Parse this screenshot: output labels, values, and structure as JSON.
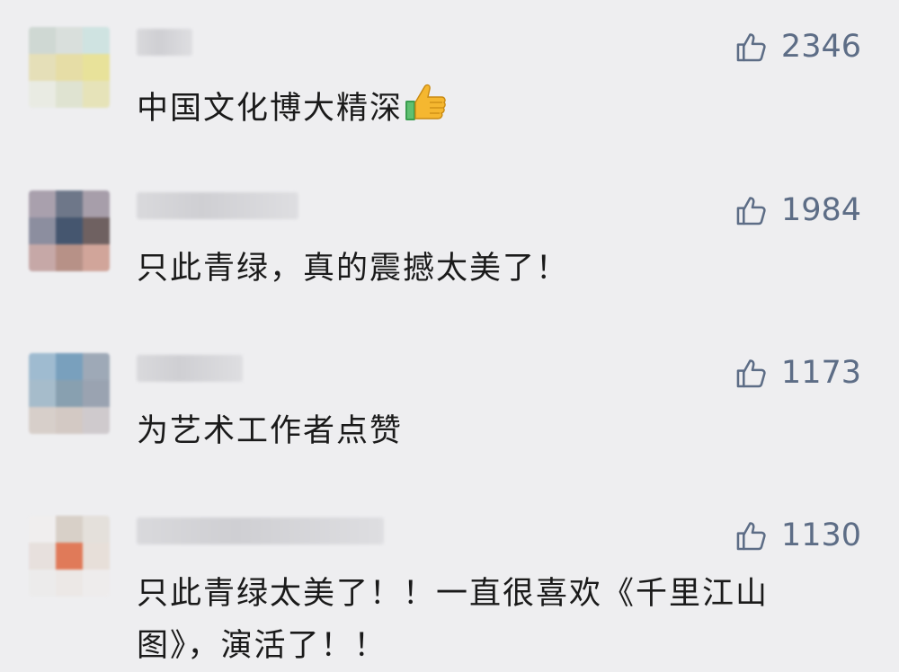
{
  "comments": [
    {
      "text": "中国文化博大精深",
      "emoji": "thumbs-up-emoji",
      "likes": "2346",
      "avatar_colors": [
        "#cfd8d3",
        "#d9dfdc",
        "#cfe3e1",
        "#e5dfb8",
        "#e6dda6",
        "#e8e29a",
        "#e9ebe3",
        "#dfe3d1",
        "#e6e3b9"
      ]
    },
    {
      "text": "只此青绿，真的震撼太美了！",
      "likes": "1984",
      "avatar_colors": [
        "#a9a0ad",
        "#6e7789",
        "#a79eaa",
        "#8c8e9f",
        "#45566f",
        "#6f6161",
        "#c6a8a7",
        "#b79187",
        "#d1a59a"
      ]
    },
    {
      "text": "为艺术工作者点赞",
      "likes": "1173",
      "avatar_colors": [
        "#9fbbd0",
        "#79a0bd",
        "#9ea9b7",
        "#a6bccb",
        "#88a0b0",
        "#9aa3b1",
        "#d7cfca",
        "#d3c9c4",
        "#cfcacd"
      ]
    },
    {
      "text": "只此青绿太美了！！一直很喜欢《千里江山图》，演活了！！",
      "likes": "1130",
      "avatar_colors": [
        "#f0eeee",
        "#d8d0c8",
        "#e4e0db",
        "#e7e0dd",
        "#e07a59",
        "#e7dfd9",
        "#ecebeb",
        "#ece8e6",
        "#eeecec"
      ]
    }
  ]
}
